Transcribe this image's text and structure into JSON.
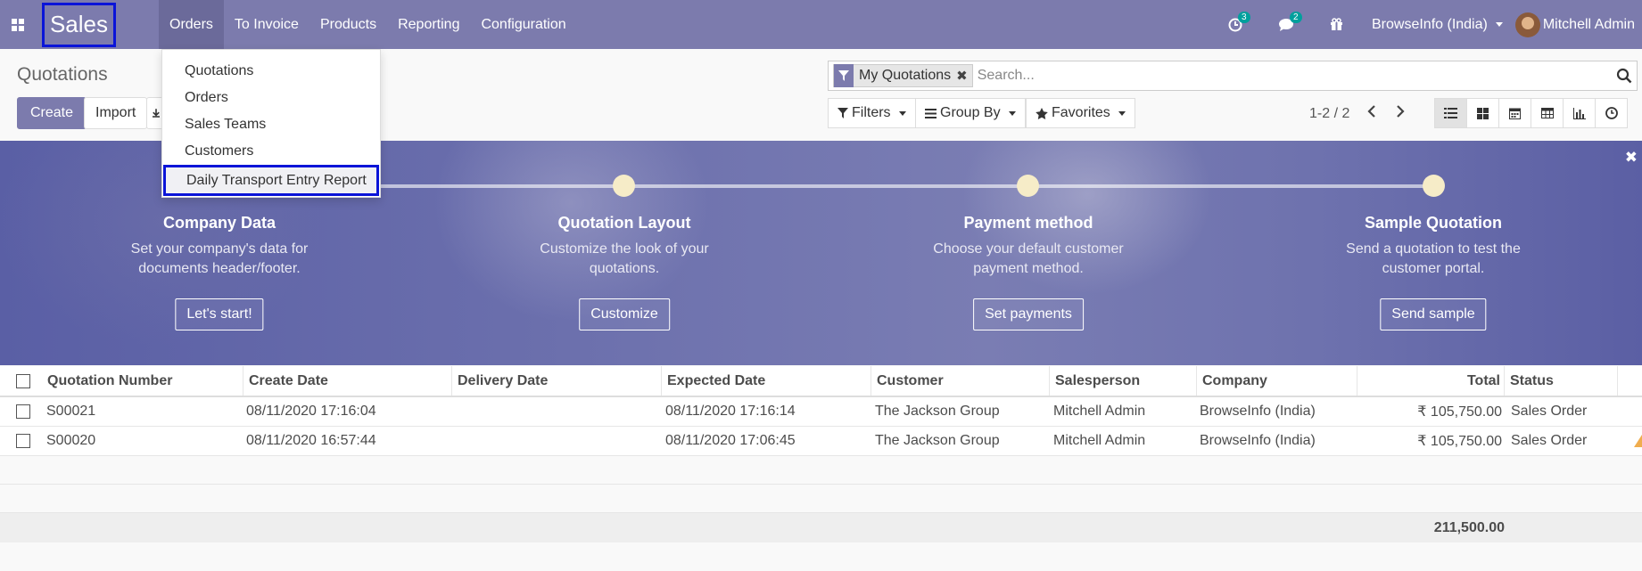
{
  "app": {
    "name": "Sales"
  },
  "navbar": {
    "menus": [
      {
        "label": "Orders",
        "active": true
      },
      {
        "label": "To Invoice"
      },
      {
        "label": "Products"
      },
      {
        "label": "Reporting"
      },
      {
        "label": "Configuration"
      }
    ],
    "activities_icon": "clock-icon",
    "activities_count": "3",
    "messages_icon": "chat-icon",
    "messages_count": "2",
    "gift_icon": "gift-icon",
    "company": "BrowseInfo (India)",
    "user": "Mitchell Admin",
    "accent_color": "#7c7bad",
    "highlight_color": "#0a14d8"
  },
  "orders_menu": {
    "items": [
      "Quotations",
      "Orders",
      "Sales Teams",
      "Customers",
      "Daily Transport Entry Report"
    ],
    "highlighted": "Daily Transport Entry Report"
  },
  "control_panel": {
    "title": "Quotations",
    "create_label": "Create",
    "import_label": "Import",
    "facet_label": "My Quotations",
    "search_placeholder": "Search...",
    "filters_label": "Filters",
    "groupby_label": "Group By",
    "favorites_label": "Favorites",
    "pager": "1-2 / 2",
    "views": [
      "list-icon",
      "kanban-icon",
      "calendar-icon",
      "pivot-icon",
      "graph-icon",
      "activity-icon"
    ],
    "active_view": "list-icon"
  },
  "onboarding": {
    "steps": [
      {
        "title": "Company Data",
        "desc": "Set your company's data for documents header/footer.",
        "button": "Let's start!"
      },
      {
        "title": "Quotation Layout",
        "desc": "Customize the look of your quotations.",
        "button": "Customize"
      },
      {
        "title": "Payment method",
        "desc": "Choose your default customer payment method.",
        "button": "Set payments"
      },
      {
        "title": "Sample Quotation",
        "desc": "Send a quotation to test the customer portal.",
        "button": "Send sample"
      }
    ]
  },
  "table": {
    "columns": [
      "Quotation Number",
      "Create Date",
      "Delivery Date",
      "Expected Date",
      "Customer",
      "Salesperson",
      "Company",
      "Total",
      "Status"
    ],
    "rows": [
      {
        "number": "S00021",
        "create_date": "08/11/2020 17:16:04",
        "delivery_date": "",
        "expected_date": "08/11/2020 17:16:14",
        "customer": "The Jackson Group",
        "salesperson": "Mitchell Admin",
        "company": "BrowseInfo (India)",
        "total": "₹ 105,750.00",
        "status": "Sales Order"
      },
      {
        "number": "S00020",
        "create_date": "08/11/2020 16:57:44",
        "delivery_date": "",
        "expected_date": "08/11/2020 17:06:45",
        "customer": "The Jackson Group",
        "salesperson": "Mitchell Admin",
        "company": "BrowseInfo (India)",
        "total": "₹ 105,750.00",
        "status": "Sales Order"
      }
    ],
    "sum_total": "211,500.00"
  }
}
